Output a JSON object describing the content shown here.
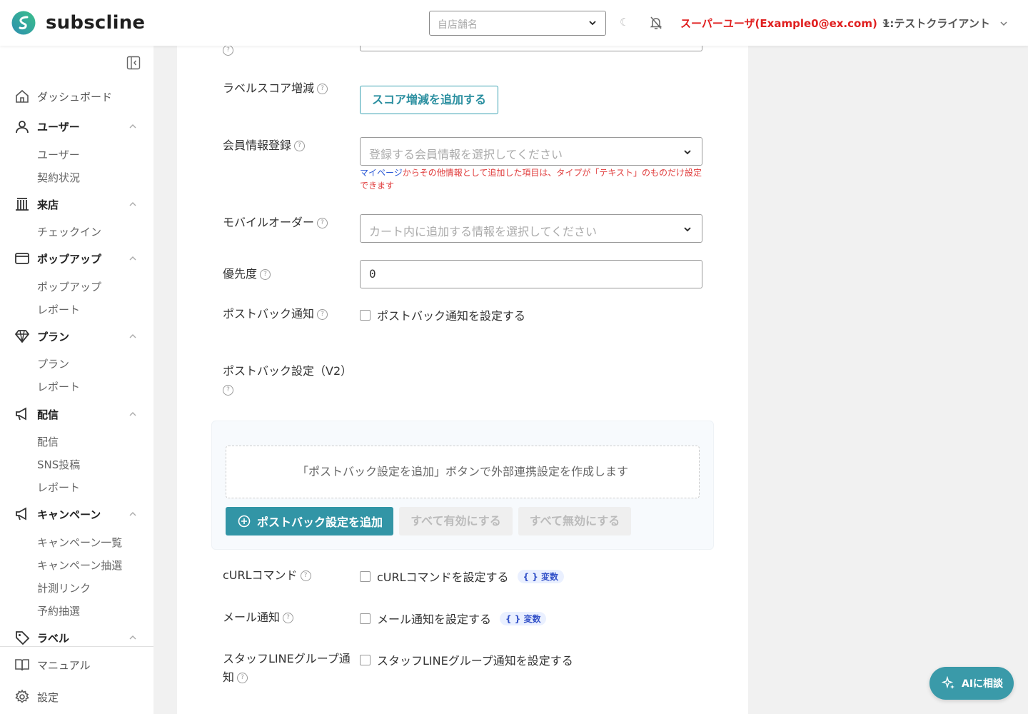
{
  "header": {
    "logo_text": "subscline",
    "store_placeholder": "自店舗名",
    "user_label": "スーパーユーザ(Example0@ex.com)",
    "client_label": "1:テストクライアント",
    "brand_colors": {
      "teal": "#3295a6",
      "green": "#3cc08a",
      "red": "#e02020"
    }
  },
  "sidebar": {
    "items": [
      {
        "label": "ダッシュボード",
        "icon": "home-icon"
      },
      {
        "label": "ユーザー",
        "icon": "user-icon",
        "children": [
          "ユーザー",
          "契約状況"
        ]
      },
      {
        "label": "来店",
        "icon": "building-icon",
        "children": [
          "チェックイン"
        ]
      },
      {
        "label": "ポップアップ",
        "icon": "window-icon",
        "children": [
          "ポップアップ",
          "レポート"
        ]
      },
      {
        "label": "プラン",
        "icon": "diamond-icon",
        "children": [
          "プラン",
          "レポート"
        ]
      },
      {
        "label": "配信",
        "icon": "megaphone-icon",
        "children": [
          "配信",
          "SNS投稿",
          "レポート"
        ]
      },
      {
        "label": "キャンペーン",
        "icon": "megaphone-icon",
        "children": [
          "キャンペーン一覧",
          "キャンペーン抽選",
          "計測リンク",
          "予約抽選"
        ]
      },
      {
        "label": "ラベル",
        "icon": "tag-icon"
      }
    ],
    "bottom": [
      {
        "label": "マニュアル",
        "icon": "book-icon"
      },
      {
        "label": "設定",
        "icon": "gear-icon"
      }
    ]
  },
  "form": {
    "label_score": "ラベルスコア増減",
    "label_score_button": "スコア増減を追加する",
    "member_info": "会員情報登録",
    "member_info_placeholder": "登録する会員情報を選択してください",
    "member_note_link": "マイページ",
    "member_note_text": "からその他情報として追加した項目は、タイプが「テキスト」のものだけ設定できます",
    "mobile_order": "モバイルオーダー",
    "mobile_order_placeholder": "カート内に追加する情報を選択してください",
    "priority": "優先度",
    "priority_value": "0",
    "postback": "ポストバック通知",
    "postback_check": "ポストバック通知を設定する",
    "postback_v2": "ポストバック設定（V2）",
    "postback_empty": "「ポストバック設定を追加」ボタンで外部連携設定を作成します",
    "postback_add": "ポストバック設定を追加",
    "enable_all": "すべて有効にする",
    "disable_all": "すべて無効にする",
    "curl": "cURLコマンド",
    "curl_check": "cURLコマンドを設定する",
    "var_badge": "{ } 変数",
    "mail": "メール通知",
    "mail_check": "メール通知を設定する",
    "staff_line": "スタッフLINEグループ通知",
    "staff_line_check": "スタッフLINEグループ通知を設定する"
  },
  "ai_button": "AIに相談"
}
